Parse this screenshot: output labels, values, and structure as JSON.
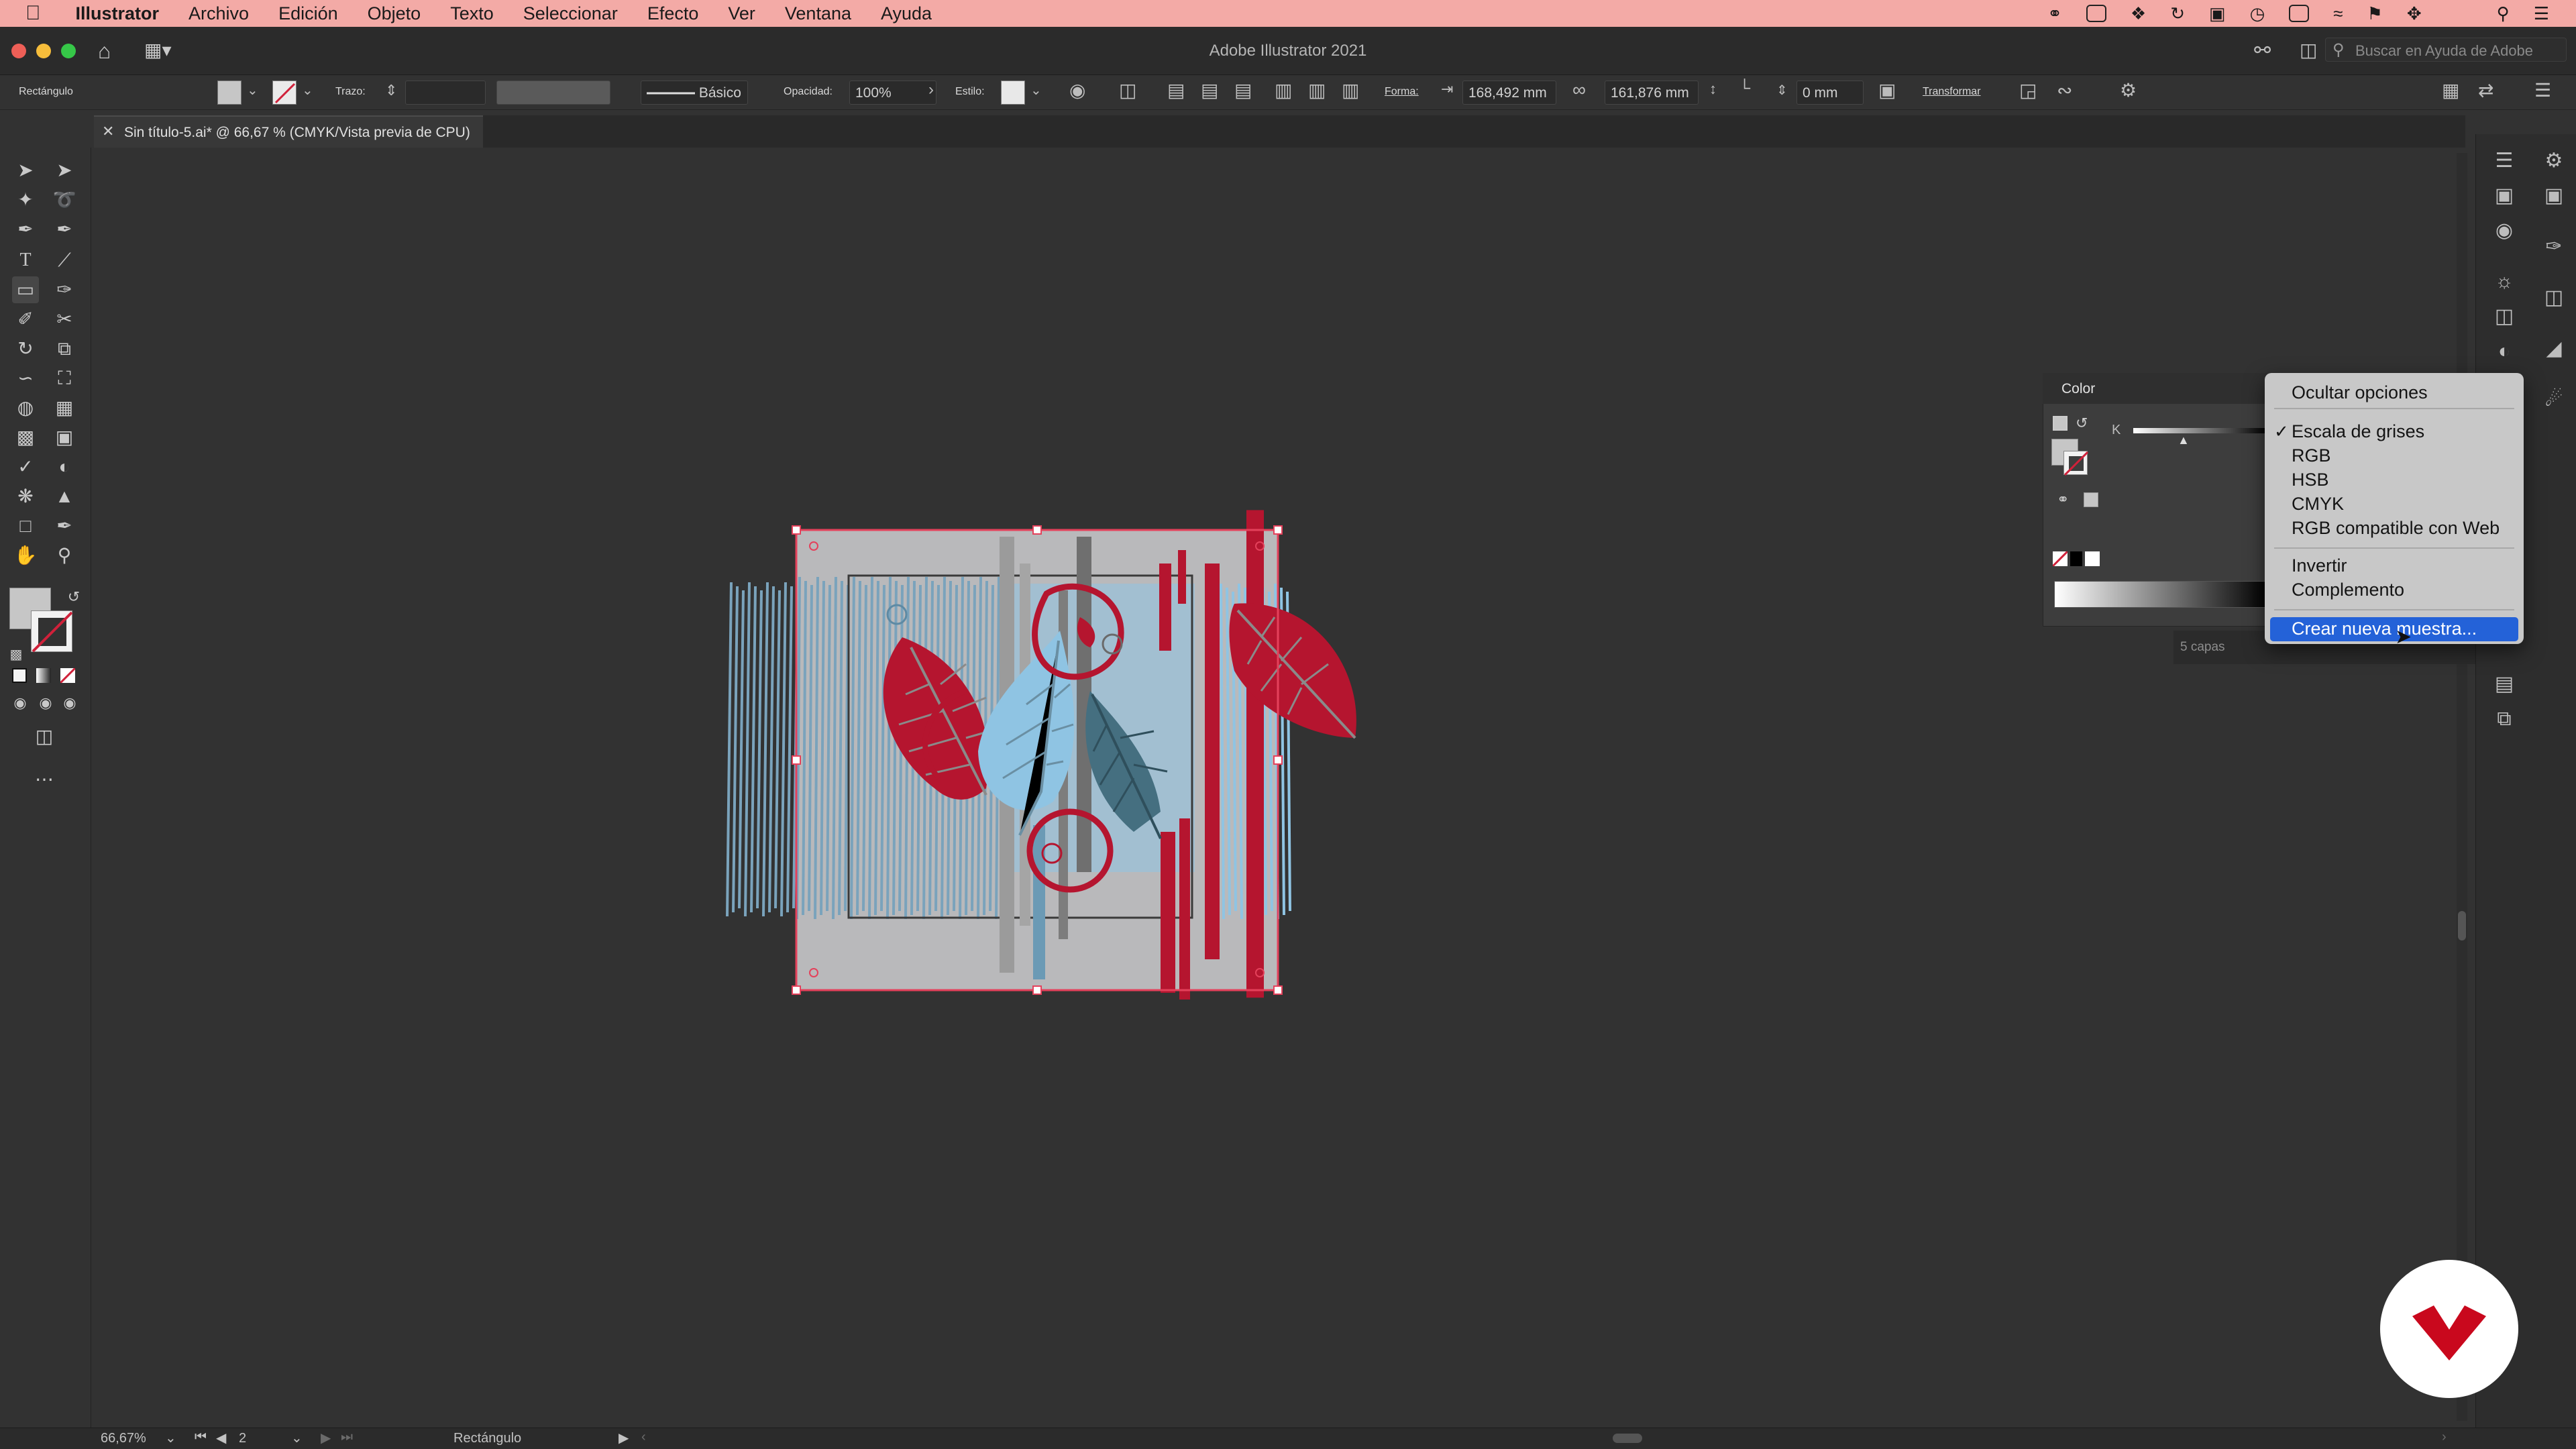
{
  "menubar": {
    "app_name": "Illustrator",
    "items": [
      "Archivo",
      "Edición",
      "Objeto",
      "Texto",
      "Seleccionar",
      "Efecto",
      "Ver",
      "Ventana",
      "Ayuda"
    ]
  },
  "window": {
    "title": "Adobe Illustrator 2021",
    "search_placeholder": "Buscar en Ayuda de Adobe"
  },
  "controlbar": {
    "object_type": "Rectángulo",
    "stroke_label": "Trazo:",
    "brush_label": "Básico",
    "opacity_label": "Opacidad:",
    "opacity_value": "100%",
    "style_label": "Estilo:",
    "shape_label": "Forma:",
    "width_value": "168,492 mm",
    "height_value": "161,876 mm",
    "corner_value": "0 mm",
    "transform_label": "Transformar"
  },
  "document": {
    "tab_title": "Sin título-5.ai* @ 66,67 % (CMYK/Vista previa de CPU)"
  },
  "artwork": {
    "colors": {
      "background": "#b9b9bb",
      "red": "#b5152f",
      "blue": "#7aa3bc",
      "light_blue": "#8fc4e3",
      "teal": "#456f80",
      "gray_stripe": "#8a8a8a",
      "selection": "#e4415b"
    }
  },
  "color_panel": {
    "title": "Color",
    "slider_label": "K",
    "layers_count": "5 capas"
  },
  "flyout_menu": {
    "hide_options": "Ocultar opciones",
    "modes": [
      "Escala de grises",
      "RGB",
      "HSB",
      "CMYK",
      "RGB compatible con Web"
    ],
    "checked_mode": "Escala de grises",
    "invert": "Invertir",
    "complement": "Complemento",
    "create_swatch": "Crear nueva muestra..."
  },
  "statusbar": {
    "zoom": "66,67%",
    "artboard_number": "2",
    "current_tool": "Rectángulo"
  }
}
